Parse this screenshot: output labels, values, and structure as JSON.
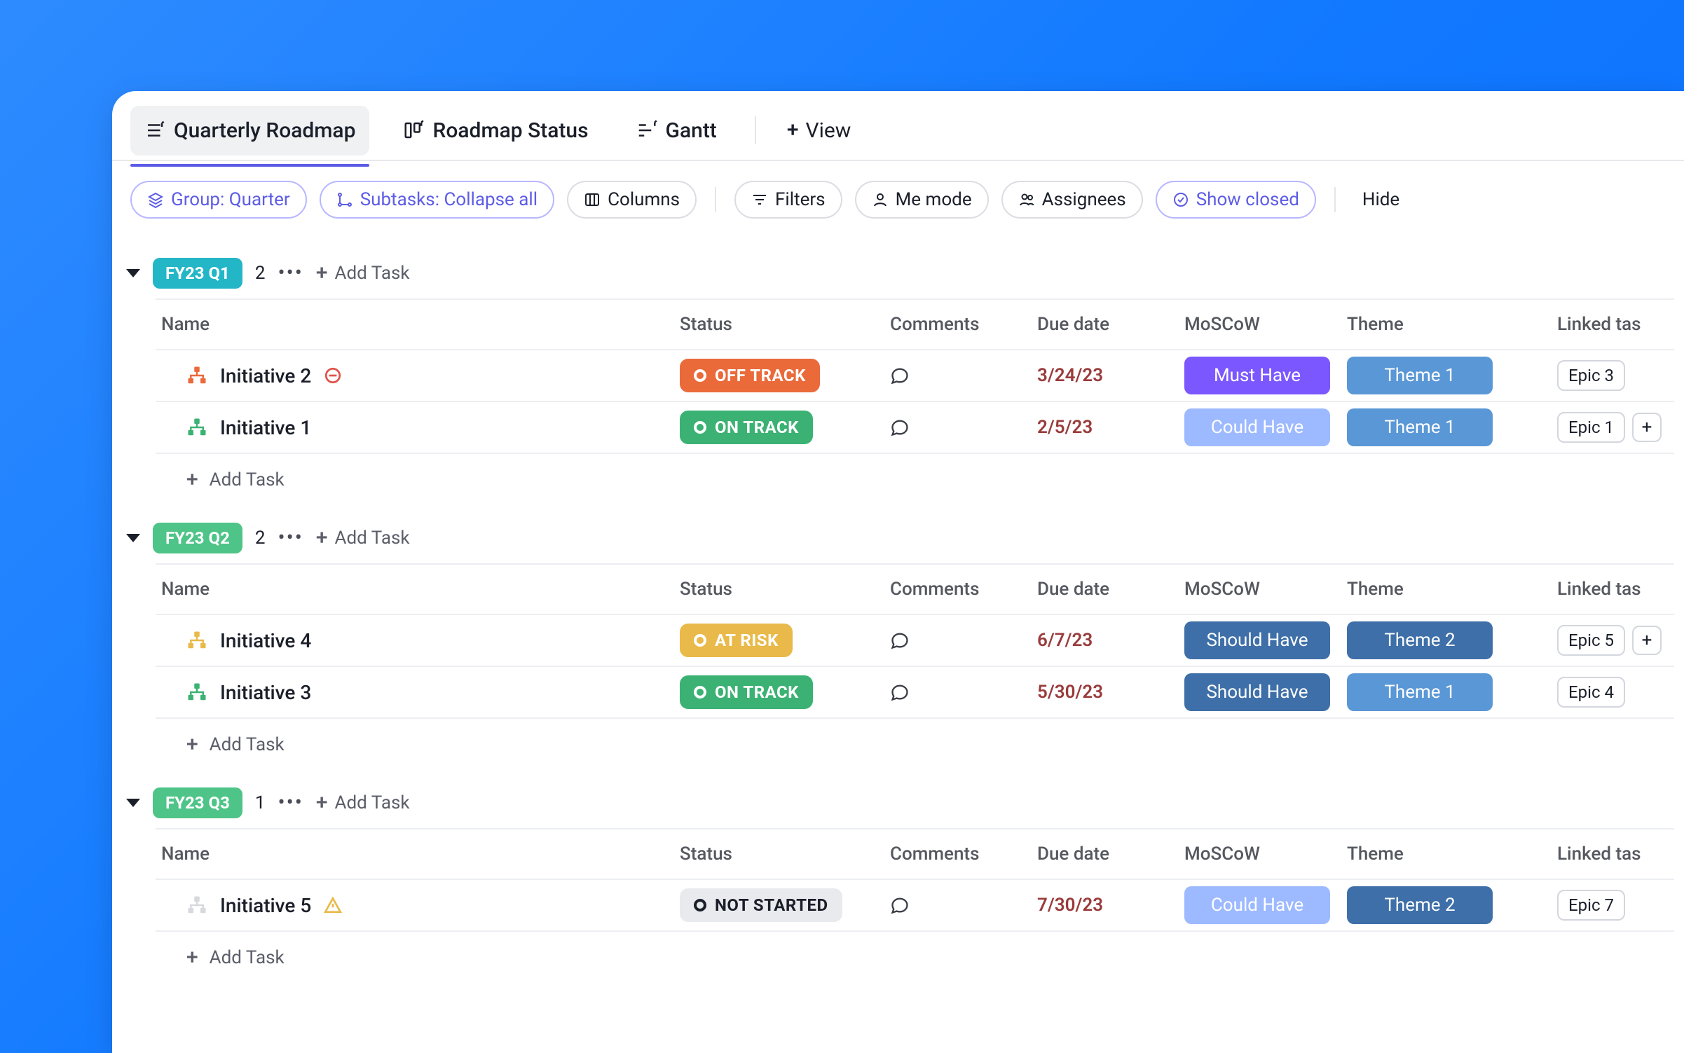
{
  "views": {
    "tabs": [
      {
        "label": "Quarterly Roadmap",
        "icon": "list-pin",
        "active": true
      },
      {
        "label": "Roadmap Status",
        "icon": "board-pin",
        "active": false
      },
      {
        "label": "Gantt",
        "icon": "gantt-pin",
        "active": false
      }
    ],
    "add_label": "View"
  },
  "toolbar": {
    "group": "Group: Quarter",
    "subtasks": "Subtasks: Collapse all",
    "columns": "Columns",
    "filters": "Filters",
    "me_mode": "Me mode",
    "assignees": "Assignees",
    "show_closed": "Show closed",
    "hide": "Hide"
  },
  "columns": {
    "name": "Name",
    "status": "Status",
    "comments": "Comments",
    "due": "Due date",
    "moscow": "MoSCoW",
    "theme": "Theme",
    "linked": "Linked tas"
  },
  "add_task_label": "Add Task",
  "colors": {
    "off_track": "#ea6a3a",
    "on_track": "#3bb273",
    "at_risk": "#e9b949",
    "not_started": "#e9eaee",
    "must_have": "#7b57ff",
    "should_have": "#3e6fa8",
    "could_have": "#9db9ff",
    "theme1": "#5a97d6",
    "theme2": "#3e6fa8",
    "due_highlight": "#9a3b3b",
    "due_normal": "#1b1f2a",
    "q1_bg": "#23b6c7",
    "q_bg": "#4ec488"
  },
  "groups": [
    {
      "id": "q1",
      "label": "FY23 Q1",
      "pill_color_key": "q1_bg",
      "count": "2",
      "rows": [
        {
          "title": "Initiative 2",
          "icon_color": "#ea6a3a",
          "blocker": true,
          "status": {
            "text": "OFF TRACK",
            "color_key": "off_track"
          },
          "due": "3/24/23",
          "due_color_key": "due_highlight",
          "moscow": {
            "text": "Must Have",
            "color_key": "must_have"
          },
          "theme": {
            "text": "Theme 1",
            "color_key": "theme1"
          },
          "linked": [
            "Epic 3"
          ],
          "linked_plus": false
        },
        {
          "title": "Initiative 1",
          "icon_color": "#3bb273",
          "blocker": false,
          "status": {
            "text": "ON TRACK",
            "color_key": "on_track"
          },
          "due": "2/5/23",
          "due_color_key": "due_highlight",
          "moscow": {
            "text": "Could Have",
            "color_key": "could_have"
          },
          "theme": {
            "text": "Theme 1",
            "color_key": "theme1"
          },
          "linked": [
            "Epic 1"
          ],
          "linked_plus": true
        }
      ]
    },
    {
      "id": "q2",
      "label": "FY23 Q2",
      "pill_color_key": "q_bg",
      "count": "2",
      "rows": [
        {
          "title": "Initiative 4",
          "icon_color": "#e9b949",
          "blocker": false,
          "status": {
            "text": "AT RISK",
            "color_key": "at_risk"
          },
          "due": "6/7/23",
          "due_color_key": "due_highlight",
          "moscow": {
            "text": "Should Have",
            "color_key": "should_have"
          },
          "theme": {
            "text": "Theme 2",
            "color_key": "theme2"
          },
          "linked": [
            "Epic 5"
          ],
          "linked_plus": true
        },
        {
          "title": "Initiative 3",
          "icon_color": "#3bb273",
          "blocker": false,
          "status": {
            "text": "ON TRACK",
            "color_key": "on_track"
          },
          "due": "5/30/23",
          "due_color_key": "due_highlight",
          "moscow": {
            "text": "Should Have",
            "color_key": "should_have"
          },
          "theme": {
            "text": "Theme 1",
            "color_key": "theme1"
          },
          "linked": [
            "Epic 4"
          ],
          "linked_plus": false
        }
      ]
    },
    {
      "id": "q3",
      "label": "FY23 Q3",
      "pill_color_key": "q_bg",
      "count": "1",
      "rows": [
        {
          "title": "Initiative 5",
          "icon_color": "#d7d9df",
          "blocker": false,
          "warning": true,
          "status": {
            "text": "NOT STARTED",
            "color_key": "not_started",
            "not_started": true
          },
          "due": "7/30/23",
          "due_color_key": "due_highlight",
          "moscow": {
            "text": "Could Have",
            "color_key": "could_have"
          },
          "theme": {
            "text": "Theme 2",
            "color_key": "theme2"
          },
          "linked": [
            "Epic 7"
          ],
          "linked_plus": false
        }
      ]
    }
  ]
}
